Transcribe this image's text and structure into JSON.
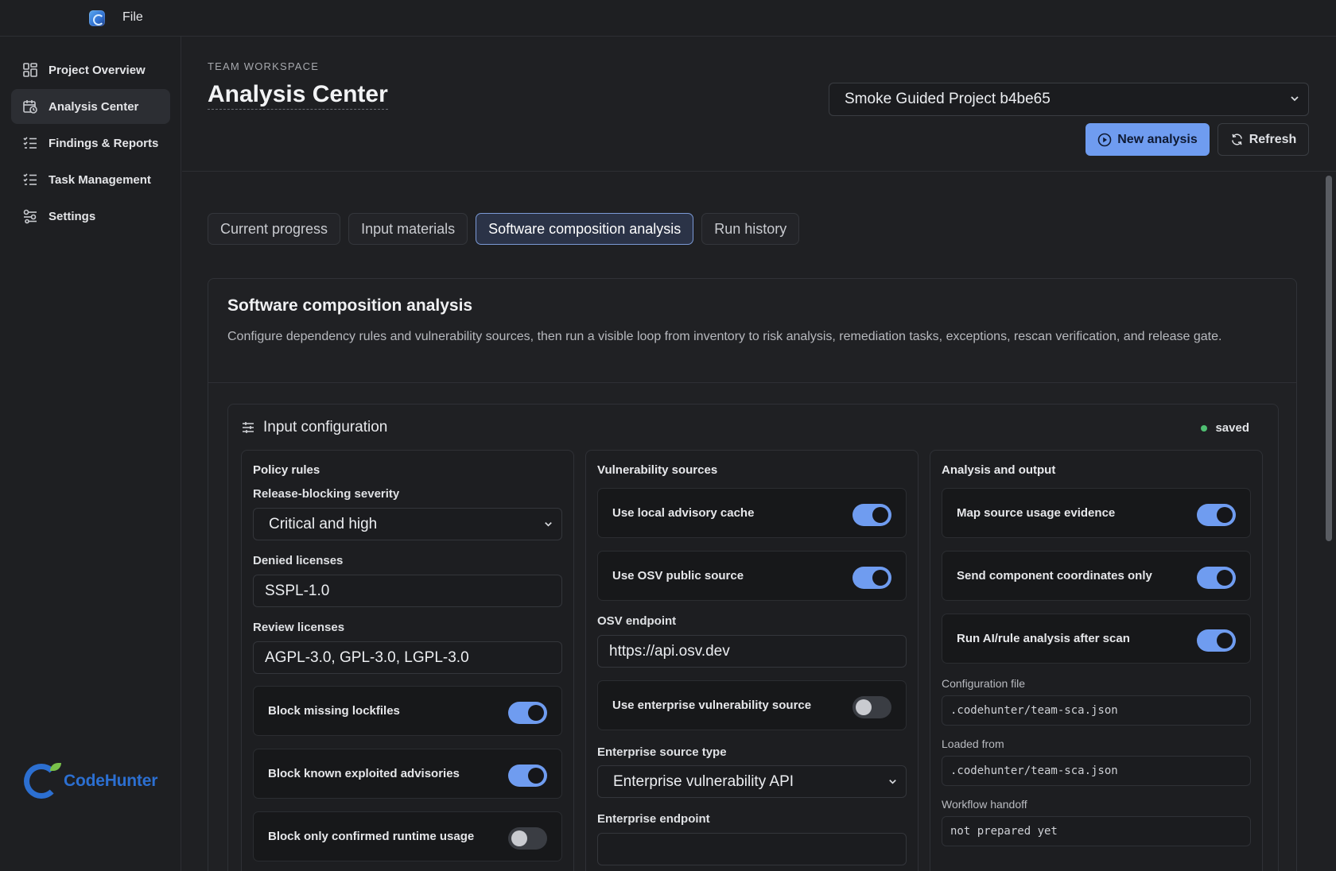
{
  "topbar": {
    "file_label": "File"
  },
  "sidebar": {
    "items": [
      {
        "label": "Project Overview",
        "icon": "dashboard-icon"
      },
      {
        "label": "Analysis Center",
        "icon": "calendar-clock-icon",
        "active": true
      },
      {
        "label": "Findings & Reports",
        "icon": "checklist-icon"
      },
      {
        "label": "Task Management",
        "icon": "checklist-icon"
      },
      {
        "label": "Settings",
        "icon": "sliders-icon"
      }
    ],
    "brand": "CodeHunter"
  },
  "header": {
    "eyebrow": "TEAM WORKSPACE",
    "title": "Analysis Center",
    "project_selected": "Smoke Guided Project b4be65",
    "new_analysis_label": "New analysis",
    "refresh_label": "Refresh"
  },
  "tabs": [
    {
      "label": "Current progress"
    },
    {
      "label": "Input materials"
    },
    {
      "label": "Software composition analysis",
      "active": true
    },
    {
      "label": "Run history"
    }
  ],
  "sca": {
    "title": "Software composition analysis",
    "description": "Configure dependency rules and vulnerability sources, then run a visible loop from inventory to risk analysis, remediation tasks, exceptions, rescan verification, and release gate.",
    "input_config": {
      "title": "Input configuration",
      "status": "saved",
      "status_color": "#4fbf72"
    },
    "policy": {
      "title": "Policy rules",
      "severity_label": "Release-blocking severity",
      "severity_value": "Critical and high",
      "denied_label": "Denied licenses",
      "denied_value": "SSPL-1.0",
      "review_label": "Review licenses",
      "review_value": "AGPL-3.0, GPL-3.0, LGPL-3.0",
      "toggles": [
        {
          "label": "Block missing lockfiles",
          "on": true
        },
        {
          "label": "Block known exploited advisories",
          "on": true
        },
        {
          "label": "Block only confirmed runtime usage",
          "on": false
        }
      ]
    },
    "vuln": {
      "title": "Vulnerability sources",
      "toggles": [
        {
          "label": "Use local advisory cache",
          "on": true
        },
        {
          "label": "Use OSV public source",
          "on": true
        },
        {
          "label": "Use enterprise vulnerability source",
          "on": false
        }
      ],
      "osv_label": "OSV endpoint",
      "osv_value": "https://api.osv.dev",
      "ent_type_label": "Enterprise source type",
      "ent_type_value": "Enterprise vulnerability API",
      "ent_endpoint_label": "Enterprise endpoint",
      "ent_endpoint_value": ""
    },
    "output": {
      "title": "Analysis and output",
      "toggles": [
        {
          "label": "Map source usage evidence",
          "on": true
        },
        {
          "label": "Send component coordinates only",
          "on": true
        },
        {
          "label": "Run AI/rule analysis after scan",
          "on": true
        }
      ],
      "config_file_label": "Configuration file",
      "config_file_value": ".codehunter/team-sca.json",
      "loaded_from_label": "Loaded from",
      "loaded_from_value": ".codehunter/team-sca.json",
      "handoff_label": "Workflow handoff",
      "handoff_value": "not prepared yet"
    }
  },
  "colors": {
    "accent": "#6f9cf0",
    "background": "#1f2023"
  }
}
